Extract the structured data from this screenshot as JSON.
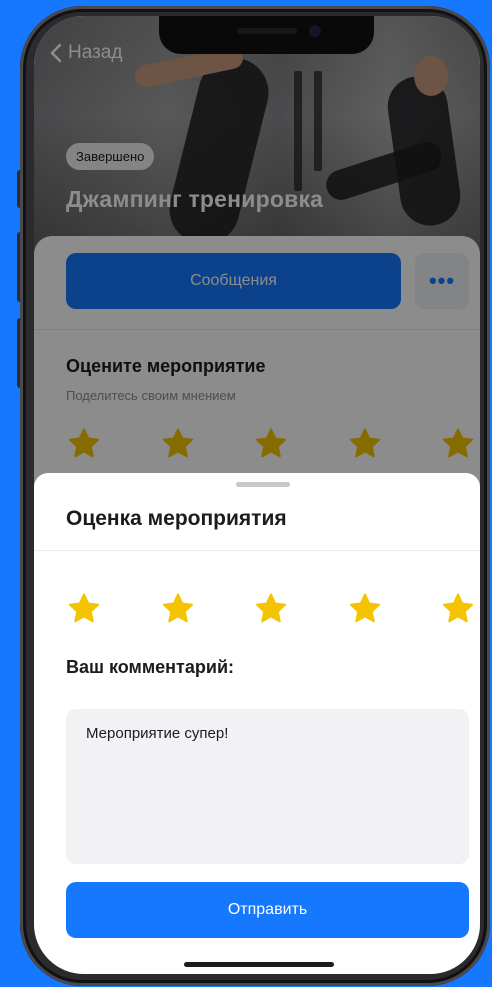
{
  "nav": {
    "back_label": "Назад"
  },
  "event": {
    "status": "Завершено",
    "title": "Джампинг тренировка"
  },
  "actions": {
    "messages_label": "Сообщения",
    "more_label": "•••"
  },
  "rating_section": {
    "title": "Оцените мероприятие",
    "subtitle": "Поделитесь своим мнением",
    "stars_filled": 5,
    "stars_total": 5
  },
  "sheet": {
    "title": "Оценка мероприятия",
    "rating": 5,
    "rating_max": 5,
    "comment_label": "Ваш комментарий:",
    "comment_value": "Мероприятие супер!",
    "submit_label": "Отправить"
  },
  "colors": {
    "accent": "#1677ff",
    "star": "#f5c400",
    "background": "#1677ff"
  }
}
